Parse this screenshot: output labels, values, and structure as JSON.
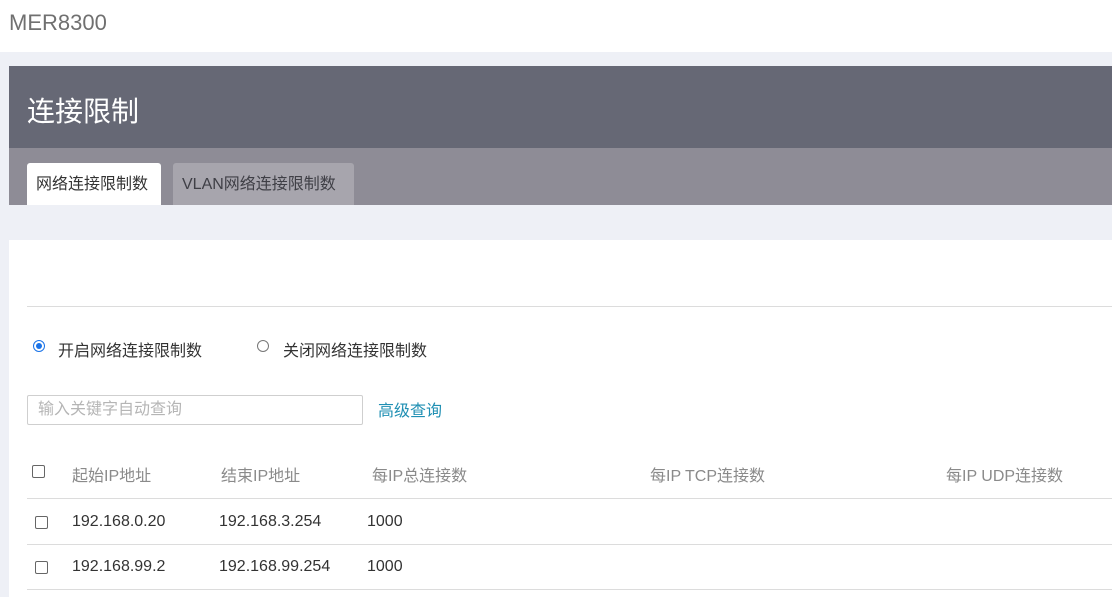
{
  "app": {
    "title": "MER8300"
  },
  "panel": {
    "title": "连接限制"
  },
  "tabs": [
    {
      "label": "网络连接限制数",
      "active": true
    },
    {
      "label": "VLAN网络连接限制数",
      "active": false
    }
  ],
  "mode": {
    "options": [
      {
        "label": "开启网络连接限制数",
        "checked": true
      },
      {
        "label": "关闭网络连接限制数",
        "checked": false
      }
    ]
  },
  "search": {
    "placeholder": "输入关键字自动查询",
    "value": ""
  },
  "advanced_search_label": "高级查询",
  "table": {
    "columns": [
      "起始IP地址",
      "结束IP地址",
      "每IP总连接数",
      "每IP TCP连接数",
      "每IP UDP连接数"
    ],
    "rows": [
      {
        "start_ip": "192.168.0.20",
        "end_ip": "192.168.3.254",
        "total": "1000",
        "tcp": "",
        "udp": ""
      },
      {
        "start_ip": "192.168.99.2",
        "end_ip": "192.168.99.254",
        "total": "1000",
        "tcp": "",
        "udp": ""
      }
    ]
  },
  "colors": {
    "accent": "#1a73e8",
    "link": "#1f8fb3",
    "header_bg": "#666875",
    "tabbar_bg": "#8e8c96"
  }
}
